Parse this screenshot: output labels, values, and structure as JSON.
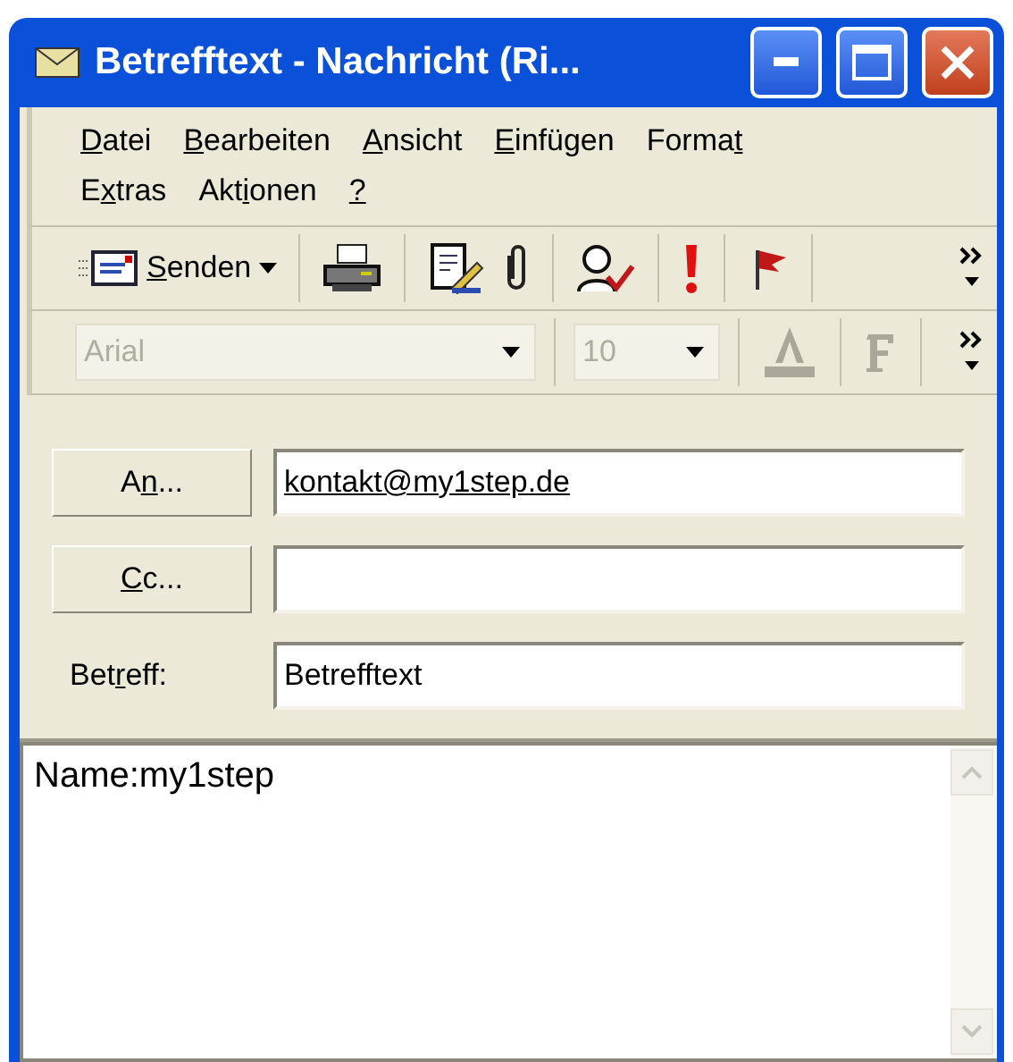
{
  "window": {
    "title": "Betrefftext - Nachricht (Ri..."
  },
  "menu": [
    {
      "key": "D",
      "post": "atei"
    },
    {
      "key": "B",
      "post": "earbeiten"
    },
    {
      "key": "A",
      "post": "nsicht"
    },
    {
      "key": "E",
      "post": "infügen"
    },
    {
      "pre": "Forma",
      "key": "t"
    },
    {
      "pre": "E",
      "key": "x",
      "post": "tras"
    },
    {
      "pre": "Akt",
      "key": "i",
      "post": "onen"
    },
    {
      "key": "?"
    }
  ],
  "toolbars": [
    {
      "groups": [
        [
          {
            "kind": "send",
            "key": "S",
            "post": "enden"
          }
        ],
        [
          {
            "kind": "print"
          }
        ],
        [
          {
            "kind": "edit"
          },
          {
            "kind": "attach"
          }
        ],
        [
          {
            "kind": "check-names"
          }
        ],
        [
          {
            "kind": "importance"
          }
        ],
        [
          {
            "kind": "flag"
          }
        ]
      ]
    },
    {
      "groups": [
        [
          {
            "kind": "combo",
            "value": "Arial",
            "disabled": true
          }
        ],
        [
          {
            "kind": "combo-small",
            "value": "10",
            "disabled": true
          }
        ],
        [
          {
            "kind": "font-color",
            "disabled": true
          }
        ],
        [
          {
            "kind": "bold",
            "disabled": true
          }
        ]
      ]
    }
  ],
  "fields": [
    {
      "kind": "button",
      "pre": "A",
      "key": "n",
      "post": "...",
      "value": "kontakt@my1step.de",
      "resolved": true
    },
    {
      "kind": "button",
      "key": "C",
      "post": "c..."
    },
    {
      "kind": "label",
      "pre": "Bet",
      "key": "r",
      "post": "eff:",
      "value": "Betrefftext"
    }
  ],
  "body": {
    "text": "Name:my1step"
  }
}
